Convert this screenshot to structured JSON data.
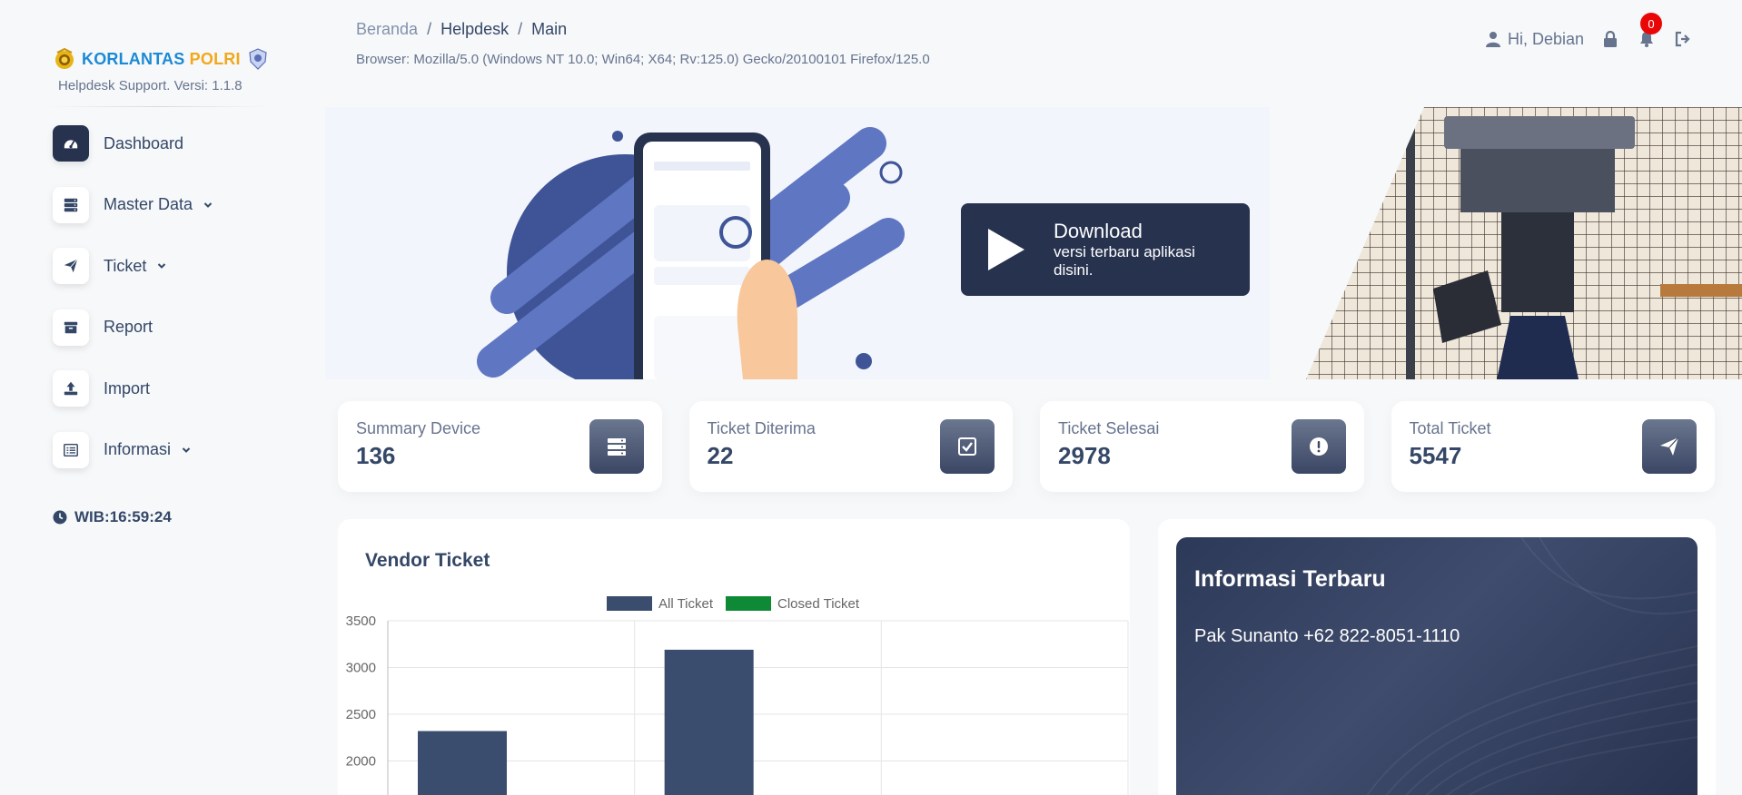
{
  "brand": {
    "name_part1": "KORLANTAS",
    "name_part2": "POLRI",
    "subtitle": "Helpdesk Support. Versi: 1.1.8"
  },
  "sidebar": {
    "items": [
      {
        "label": "Dashboard",
        "icon": "dashboard-icon",
        "active": true,
        "has_caret": false
      },
      {
        "label": "Master Data",
        "icon": "server-icon",
        "active": false,
        "has_caret": true
      },
      {
        "label": "Ticket",
        "icon": "paper-plane-icon",
        "active": false,
        "has_caret": true
      },
      {
        "label": "Report",
        "icon": "archive-icon",
        "active": false,
        "has_caret": false
      },
      {
        "label": "Import",
        "icon": "upload-icon",
        "active": false,
        "has_caret": false
      },
      {
        "label": "Informasi",
        "icon": "list-icon",
        "active": false,
        "has_caret": true
      }
    ],
    "clock_label": "WIB:",
    "clock_time": "16:59:24"
  },
  "header": {
    "breadcrumb": [
      "Beranda",
      "Helpdesk",
      "Main"
    ],
    "separator": "/",
    "browser_info": "Browser: Mozilla/5.0 (Windows NT 10.0; Win64; X64; Rv:125.0) Gecko/20100101 Firefox/125.0",
    "user_greeting": "Hi, Debian",
    "notification_count": "0"
  },
  "banner": {
    "download_title": "Download",
    "download_line1": "versi terbaru aplikasi",
    "download_line2": "disini."
  },
  "stats": [
    {
      "title": "Summary Device",
      "value": "136",
      "icon": "server-icon"
    },
    {
      "title": "Ticket Diterima",
      "value": "22",
      "icon": "check-square-icon"
    },
    {
      "title": "Ticket Selesai",
      "value": "2978",
      "icon": "exclamation-circle-icon"
    },
    {
      "title": "Total Ticket",
      "value": "5547",
      "icon": "paper-plane-icon"
    }
  ],
  "chart_panel": {
    "title": "Vendor Ticket"
  },
  "chart_data": {
    "type": "bar",
    "title": "Vendor Ticket",
    "categories": [
      "",
      "",
      ""
    ],
    "series": [
      {
        "name": "All Ticket",
        "color": "#3b4d6e",
        "values": [
          2320,
          3190,
          null
        ]
      },
      {
        "name": "Closed Ticket",
        "color": "#0e8a37",
        "values": [
          null,
          null,
          null
        ]
      }
    ],
    "y_ticks": [
      2000,
      2500,
      3000,
      3500
    ],
    "ylim": [
      1700,
      3500
    ],
    "grid": true,
    "legend": "top-center"
  },
  "info": {
    "title": "Informasi Terbaru",
    "text": "Pak Sunanto +62 822-8051-1110"
  },
  "colors": {
    "primary": "#27324f",
    "text": "#344767",
    "muted": "#67748e",
    "badge": "#ea0606",
    "bg": "#f6f8fa"
  }
}
